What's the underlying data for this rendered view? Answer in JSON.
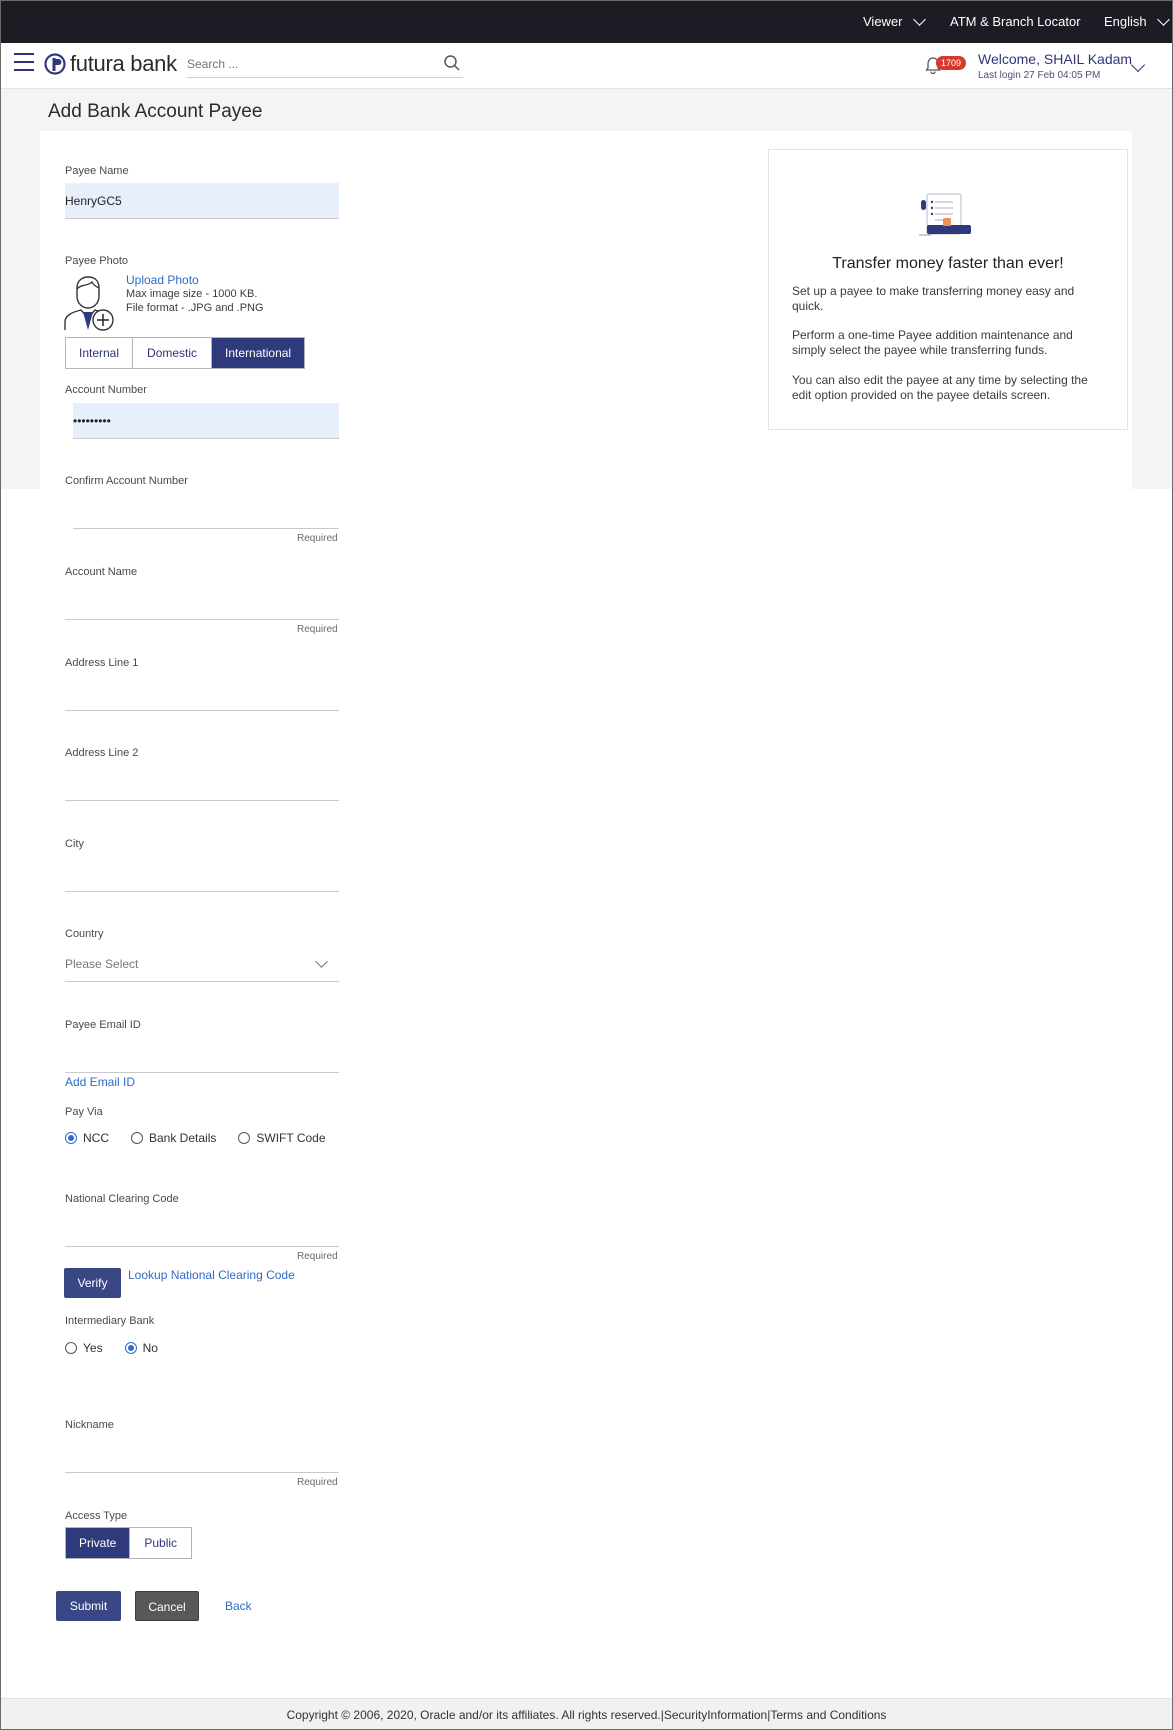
{
  "topbar": {
    "viewer": "Viewer",
    "locator": "ATM & Branch Locator",
    "language": "English"
  },
  "header": {
    "logo_text": "futura bank",
    "search_placeholder": "Search ...",
    "notification_count": "1709",
    "welcome": "Welcome, SHAIL Kadam",
    "last_login": "Last login 27 Feb 04:05 PM"
  },
  "page": {
    "title": "Add Bank Account Payee"
  },
  "form": {
    "payee_name_label": "Payee Name",
    "payee_name_value": "HenryGC5",
    "payee_photo_label": "Payee Photo",
    "upload_photo": "Upload Photo",
    "max_size_note": "Max image size - 1000 KB.",
    "format_note": "File format - .JPG and .PNG",
    "account_types": [
      "Internal",
      "Domestic",
      "International"
    ],
    "account_type_selected": "International",
    "account_number_label": "Account Number",
    "account_number_value": "•••••••••",
    "confirm_account_label": "Confirm Account Number",
    "required_text": "Required",
    "account_name_label": "Account Name",
    "address1_label": "Address Line 1",
    "address2_label": "Address Line 2",
    "city_label": "City",
    "country_label": "Country",
    "country_placeholder": "Please Select",
    "email_label": "Payee Email ID",
    "add_email": "Add Email ID",
    "pay_via_label": "Pay Via",
    "pay_via_options": [
      "NCC",
      "Bank Details",
      "SWIFT Code"
    ],
    "pay_via_selected": "NCC",
    "ncc_label": "National Clearing Code",
    "verify_button": "Verify",
    "lookup_link": "Lookup National Clearing Code",
    "intermediary_label": "Intermediary Bank",
    "intermediary_options": [
      "Yes",
      "No"
    ],
    "intermediary_selected": "No",
    "nickname_label": "Nickname",
    "access_type_label": "Access Type",
    "access_types": [
      "Private",
      "Public"
    ],
    "access_type_selected": "Private",
    "submit": "Submit",
    "cancel": "Cancel",
    "back": "Back"
  },
  "side_panel": {
    "title": "Transfer money faster than ever!",
    "p1": "Set up a payee to make transferring money easy and quick.",
    "p2": "Perform a one-time Payee addition maintenance and simply select the payee while transferring funds.",
    "p3": "You can also edit the payee at any time by selecting the edit option provided on the payee details screen."
  },
  "footer": {
    "copyright": "Copyright © 2006, 2020, Oracle and/or its affiliates. All rights reserved.",
    "security": "SecurityInformation",
    "terms": "Terms and Conditions",
    "separator": "|"
  },
  "colors": {
    "brand_navy": "#2f3a7d",
    "link_blue": "#2f6bc9",
    "topbar": "#1b1c24",
    "badge_red": "#d63a2c"
  }
}
